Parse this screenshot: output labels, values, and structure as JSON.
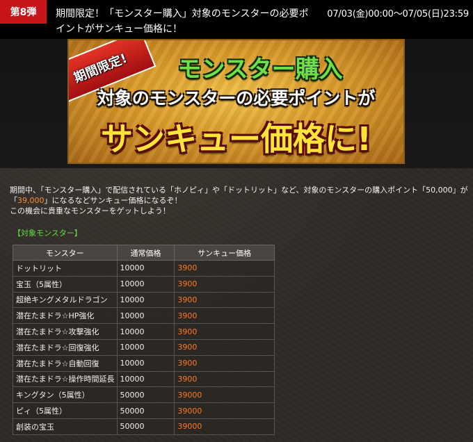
{
  "header": {
    "badge": "第8弾",
    "title": "期間限定！「モンスター購入」対象のモンスターの必要ポイントがサンキュー価格に！",
    "period": "07/03(金)00:00～07/05(日)23:59"
  },
  "banner": {
    "ribbon": "期間限定!",
    "line1": "モンスター購入",
    "line2": "対象のモンスターの必要ポイントが",
    "line3": "サンキュー価格に!"
  },
  "description": {
    "part1": "期間中、「モンスター購入」で配信されている「ホノピィ」や「ドットリット」など、対象のモンスターの購入ポイント「50,000」が「",
    "highlight": "39,000",
    "part2": "」になるなどサンキュー価格になるぞ！",
    "line2": "この機会に貴重なモンスターをゲットしよう！"
  },
  "section_label": "【対象モンスター】",
  "table": {
    "headers": [
      "モンスター",
      "通常価格",
      "サンキュー価格"
    ],
    "rows": [
      {
        "name": "ドットリット",
        "normal": "10000",
        "thanks": "3900"
      },
      {
        "name": "宝玉（5属性）",
        "normal": "10000",
        "thanks": "3900"
      },
      {
        "name": "超絶キングメタルドラゴン",
        "normal": "10000",
        "thanks": "3900"
      },
      {
        "name": "潜在たまドラ☆HP強化",
        "normal": "10000",
        "thanks": "3900"
      },
      {
        "name": "潜在たまドラ☆攻撃強化",
        "normal": "10000",
        "thanks": "3900"
      },
      {
        "name": "潜在たまドラ☆回復強化",
        "normal": "10000",
        "thanks": "3900"
      },
      {
        "name": "潜在たまドラ☆自動回復",
        "normal": "10000",
        "thanks": "3900"
      },
      {
        "name": "潜在たまドラ☆操作時間延長",
        "normal": "10000",
        "thanks": "3900"
      },
      {
        "name": "キングタン（5属性）",
        "normal": "50000",
        "thanks": "39000"
      },
      {
        "name": "ピィ（5属性）",
        "normal": "50000",
        "thanks": "39000"
      },
      {
        "name": "創装の宝玉",
        "normal": "50000",
        "thanks": "39000"
      }
    ]
  },
  "colors": {
    "badge": "#c8141a",
    "highlight": "#ff7a1e",
    "section_label": "#5fe046"
  }
}
